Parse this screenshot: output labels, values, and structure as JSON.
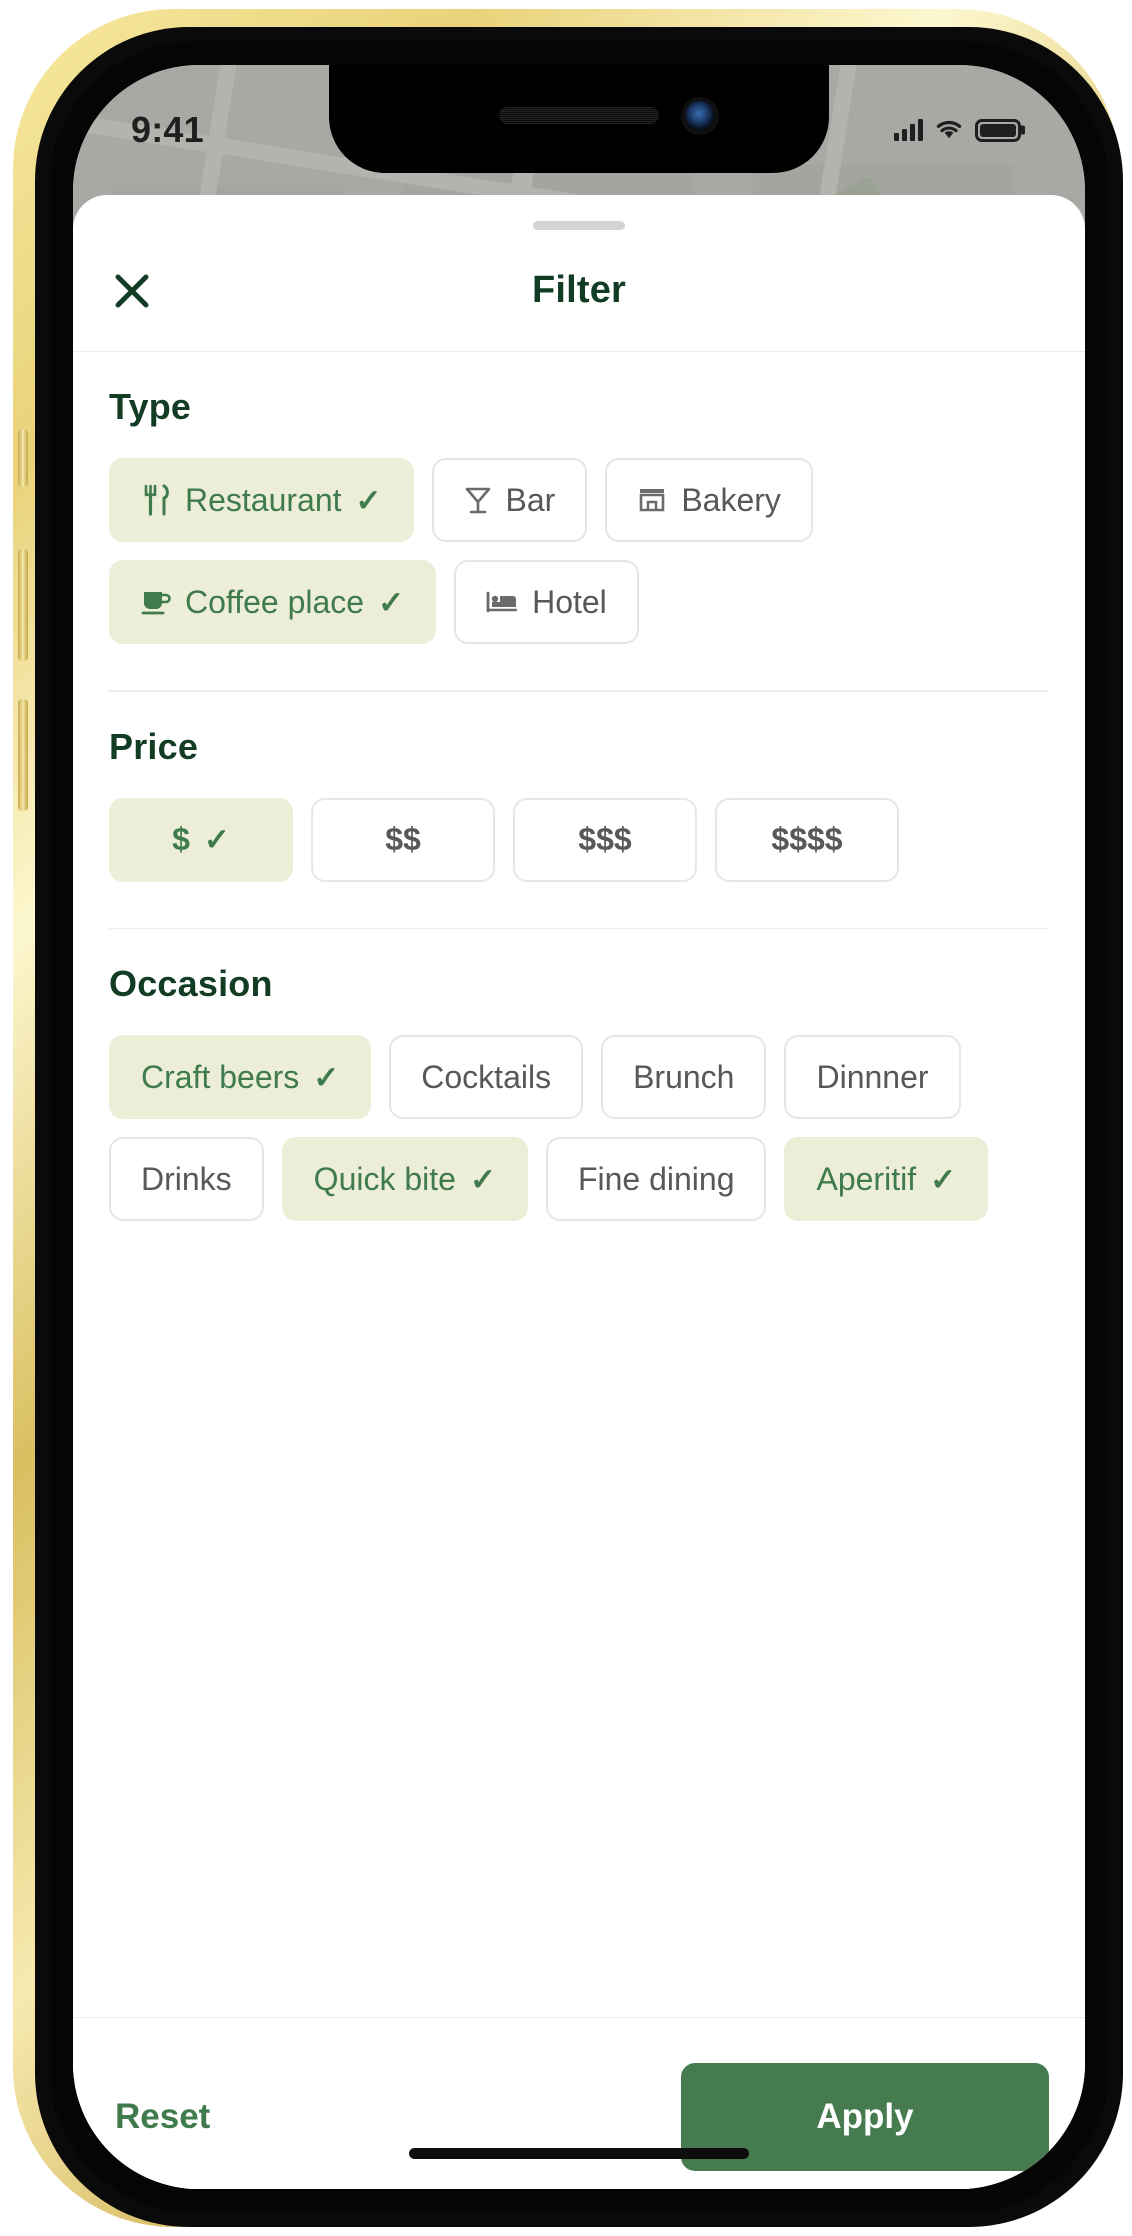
{
  "status_bar": {
    "time": "9:41",
    "cellular_icon": "signal-bars-icon",
    "wifi_icon": "wifi-icon",
    "battery_icon": "battery-full-icon"
  },
  "sheet": {
    "grabber": "drag-handle",
    "close_icon": "close-icon",
    "title": "Filter"
  },
  "sections": [
    {
      "id": "type",
      "title": "Type",
      "chips": [
        {
          "label": "Restaurant",
          "icon": "restaurant-icon",
          "selected": true,
          "check": "✓"
        },
        {
          "label": "Bar",
          "icon": "cocktail-glass-icon",
          "selected": false,
          "check": ""
        },
        {
          "label": "Bakery",
          "icon": "store-icon",
          "selected": false,
          "check": ""
        },
        {
          "label": "Coffee place",
          "icon": "coffee-cup-icon",
          "selected": true,
          "check": "✓"
        },
        {
          "label": "Hotel",
          "icon": "bed-icon",
          "selected": false,
          "check": ""
        }
      ]
    },
    {
      "id": "price",
      "title": "Price",
      "chips": [
        {
          "label": "$",
          "icon": "",
          "selected": true,
          "check": "✓"
        },
        {
          "label": "$$",
          "icon": "",
          "selected": false,
          "check": ""
        },
        {
          "label": "$$$",
          "icon": "",
          "selected": false,
          "check": ""
        },
        {
          "label": "$$$$",
          "icon": "",
          "selected": false,
          "check": ""
        }
      ]
    },
    {
      "id": "occasion",
      "title": "Occasion",
      "chips": [
        {
          "label": "Craft beers",
          "icon": "",
          "selected": true,
          "check": "✓"
        },
        {
          "label": "Cocktails",
          "icon": "",
          "selected": false,
          "check": ""
        },
        {
          "label": "Brunch",
          "icon": "",
          "selected": false,
          "check": ""
        },
        {
          "label": "Dinnner",
          "icon": "",
          "selected": false,
          "check": ""
        },
        {
          "label": "Drinks",
          "icon": "",
          "selected": false,
          "check": ""
        },
        {
          "label": "Quick bite",
          "icon": "",
          "selected": true,
          "check": "✓"
        },
        {
          "label": "Fine dining",
          "icon": "",
          "selected": false,
          "check": ""
        },
        {
          "label": "Aperitif",
          "icon": "",
          "selected": true,
          "check": "✓"
        }
      ]
    }
  ],
  "footer": {
    "reset_label": "Reset",
    "apply_label": "Apply"
  },
  "colors": {
    "brand_dark_green": "#123c24",
    "accent_green": "#3f7b4d",
    "apply_green": "#467a4f",
    "chip_selected_bg": "#edeed7",
    "chip_border": "#e6e6e6",
    "chip_text": "#585858",
    "frame_gold": "#e3c96c"
  }
}
